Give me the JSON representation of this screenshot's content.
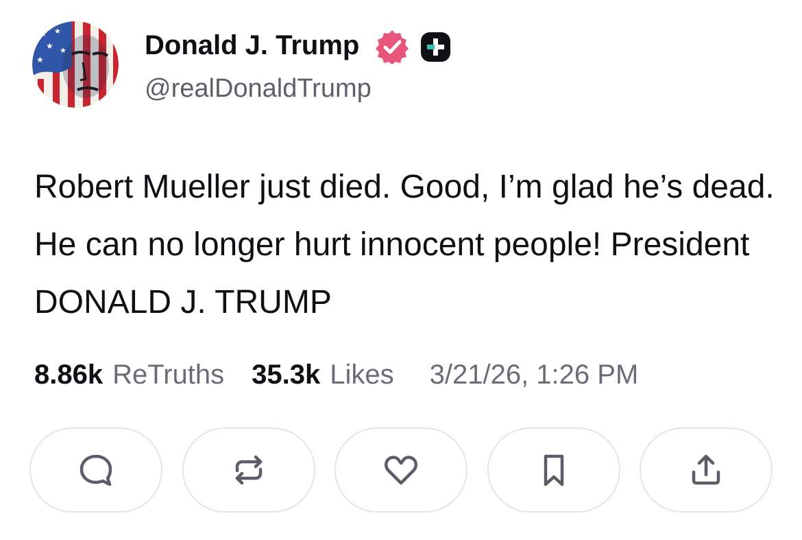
{
  "author": {
    "display_name": "Donald J. Trump",
    "handle": "@realDonaldTrump",
    "avatar_icon": "flag-portrait-avatar",
    "verified_badge_icon": "verified-check-badge-icon",
    "plus_badge_icon": "plus-badge-icon"
  },
  "post": {
    "text": "Robert Mueller just died. Good, I’m glad he’s dead. He can no longer hurt innocent people! President DONALD J. TRUMP"
  },
  "stats": {
    "retruths_count": "8.86k",
    "retruths_label": "ReTruths",
    "likes_count": "35.3k",
    "likes_label": "Likes",
    "timestamp": "3/21/26, 1:26 PM"
  },
  "actions": [
    {
      "name": "reply",
      "icon": "speech-bubble-icon"
    },
    {
      "name": "retruth",
      "icon": "repost-arrows-icon"
    },
    {
      "name": "like",
      "icon": "heart-icon"
    },
    {
      "name": "bookmark",
      "icon": "bookmark-icon"
    },
    {
      "name": "share",
      "icon": "share-upload-icon"
    }
  ],
  "colors": {
    "text_primary": "#0f0f14",
    "text_secondary": "#6b6b78",
    "verified_badge": "#e8567c",
    "button_border": "#e4e4ea",
    "icon_stroke": "#5c5c6a"
  }
}
